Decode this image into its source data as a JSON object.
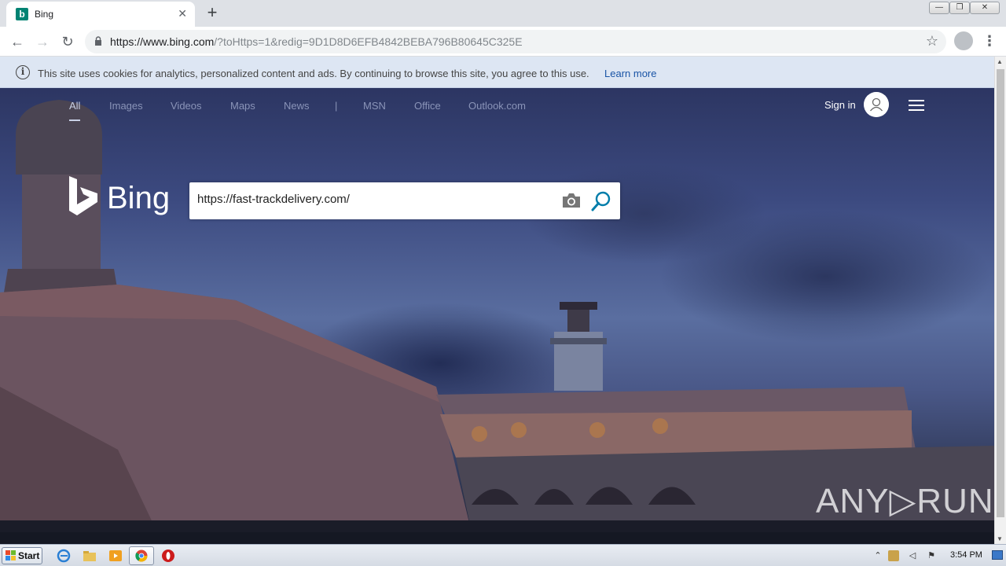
{
  "browser": {
    "tab_title": "Bing",
    "tab_favicon_letter": "b",
    "url_host": "https://www.bing.com",
    "url_rest": "/?toHttps=1&redig=9D1D8D6EFB4842BEBA796B80645C325E",
    "tab_close": "✕",
    "new_tab": "+",
    "back": "←",
    "forward": "→",
    "reload": "↻",
    "star": "☆",
    "menu": "⋮",
    "win_minimize": "—",
    "win_restore": "❐",
    "win_close": "✕"
  },
  "cookie_banner": {
    "icon": "i",
    "text": "This site uses cookies for analytics, personalized content and ads. By continuing to browse this site, you agree to this use.",
    "link": "Learn more"
  },
  "bing_nav": {
    "items": [
      "All",
      "Images",
      "Videos",
      "Maps",
      "News",
      "|",
      "MSN",
      "Office",
      "Outlook.com"
    ],
    "sign_in": "Sign in"
  },
  "bing": {
    "wordmark": "Bing",
    "search_value": "https://fast-trackdelivery.com/"
  },
  "watermark": "ANY▷RUN",
  "taskbar": {
    "start": "Start",
    "clock": "3:54 PM",
    "tray_expand": "⌃"
  },
  "colors": {
    "bing_teal": "#008373",
    "cookie_bg": "#dde6f3",
    "link_blue": "#1a55a6"
  }
}
